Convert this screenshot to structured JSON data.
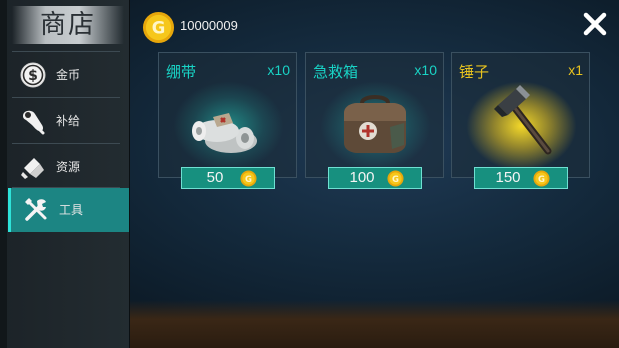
{
  "sidebar": {
    "title": "商店",
    "items": [
      {
        "label": "金币",
        "icon": "dollar-icon",
        "active": false
      },
      {
        "label": "补给",
        "icon": "meat-icon",
        "active": false
      },
      {
        "label": "资源",
        "icon": "materials-icon",
        "active": false
      },
      {
        "label": "工具",
        "icon": "tools-icon",
        "active": true
      }
    ]
  },
  "header": {
    "coin_balance": "10000009",
    "coin_icon": "gold-coin-icon",
    "close_icon": "close-icon"
  },
  "shop": {
    "items": [
      {
        "name": "绷带",
        "quantity": "x10",
        "price": "50",
        "icon": "bandage-icon"
      },
      {
        "name": "急救箱",
        "quantity": "x10",
        "price": "100",
        "icon": "first-aid-kit-icon"
      },
      {
        "name": "锤子",
        "quantity": "x1",
        "price": "150",
        "icon": "hammer-icon"
      }
    ]
  },
  "colors": {
    "accent_teal": "#19d3c5",
    "accent_gold": "#e7c21f",
    "active_tab": "#1c8583",
    "price_box": "#17907f"
  }
}
